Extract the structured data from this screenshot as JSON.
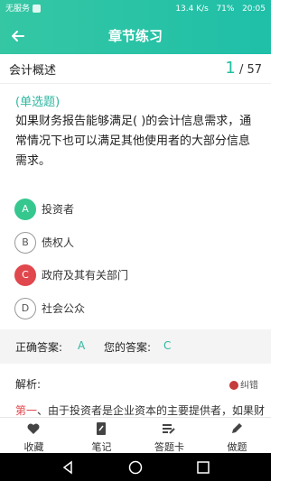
{
  "status": {
    "carrier": "无服务",
    "net_speed": "13.4 K/s",
    "battery": "71%",
    "time": "20:05"
  },
  "appbar": {
    "title": "章节练习"
  },
  "chapter": {
    "name": "会计概述",
    "current": "1",
    "total": "/ 57"
  },
  "question": {
    "type": "(单选题)",
    "text": "如果财务报告能够满足( )的会计信息需求，通常情况下也可以满足其他使用者的大部分信息需求。",
    "options": [
      {
        "letter": "A",
        "text": "投资者",
        "state": "correct"
      },
      {
        "letter": "B",
        "text": "债权人",
        "state": "normal"
      },
      {
        "letter": "C",
        "text": "政府及其有关部门",
        "state": "wrong"
      },
      {
        "letter": "D",
        "text": "社会公众",
        "state": "normal"
      }
    ]
  },
  "answer": {
    "correct_label": "正确答案:",
    "correct_value": "A",
    "yours_label": "您的答案:",
    "yours_value": "C"
  },
  "analysis": {
    "label": "解析:",
    "report_label": "纠错",
    "lead": "第一",
    "text": "、由于投资者是企业资本的主要提供者，如果财"
  },
  "bottom_nav": [
    {
      "label": "收藏",
      "icon": "heart-icon"
    },
    {
      "label": "笔记",
      "icon": "note-icon"
    },
    {
      "label": "答题卡",
      "icon": "answer-card-icon"
    },
    {
      "label": "做题",
      "icon": "pencil-icon"
    }
  ],
  "colors": {
    "accent": "#1fbfa8",
    "correct": "#36c78f",
    "wrong": "#e0484d"
  }
}
